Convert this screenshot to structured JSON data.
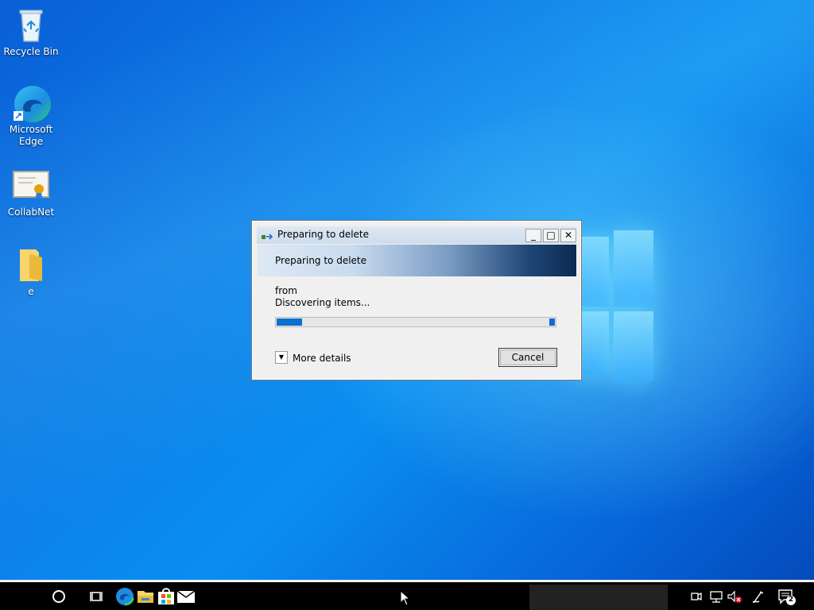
{
  "desktop": {
    "icons": [
      {
        "label": "Recycle Bin",
        "icon": "recycle-bin-icon"
      },
      {
        "label": "Microsoft Edge",
        "icon": "edge-icon"
      },
      {
        "label": "CollabNet",
        "icon": "certificate-icon"
      },
      {
        "label": "e",
        "icon": "folder-icon"
      }
    ]
  },
  "dialog": {
    "title": "Preparing to delete",
    "banner": "Preparing to delete",
    "from_label": "from",
    "status": "Discovering items...",
    "progress_fraction": 0.09,
    "more_details": "More details",
    "cancel": "Cancel",
    "minimize_icon": "minimize-icon",
    "maximize_icon": "maximize-icon",
    "close_icon": "close-icon"
  },
  "taskbar": {
    "notification_count": "2",
    "items": [
      "cortana-icon",
      "task-view-icon",
      "edge-icon",
      "file-explorer-icon",
      "store-icon",
      "mail-icon"
    ],
    "tray": [
      "meet-now-icon",
      "network-icon",
      "volume-muted-icon",
      "pen-icon",
      "notifications-icon"
    ]
  },
  "colors": {
    "accent": "#0a6fd0",
    "desktop": "#0c7fe8"
  }
}
